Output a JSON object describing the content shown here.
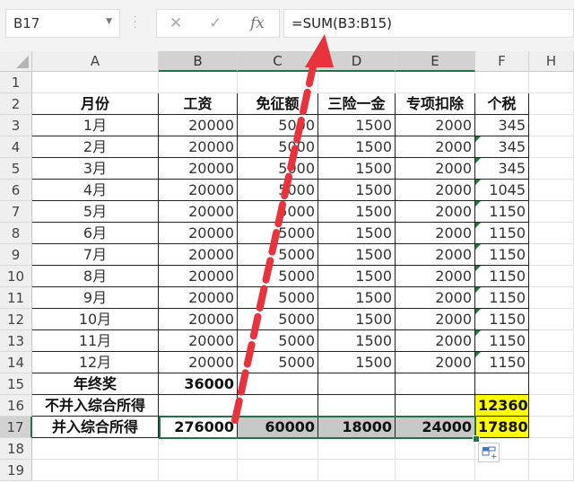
{
  "namebox": {
    "value": "B17"
  },
  "formula_bar": {
    "cancel_icon": "✕",
    "enter_icon": "✓",
    "fx_label": "fx",
    "formula": "=SUM(B3:B15)"
  },
  "columns": [
    "A",
    "B",
    "C",
    "D",
    "E",
    "F",
    "H"
  ],
  "rows": [
    "1",
    "2",
    "3",
    "4",
    "5",
    "6",
    "7",
    "8",
    "9",
    "10",
    "11",
    "12",
    "13",
    "14",
    "15",
    "16",
    "17",
    "18",
    "19"
  ],
  "headers": {
    "month": "月份",
    "salary": "工资",
    "exemption": "免征额",
    "insurance": "三险一金",
    "special_deduction": "专项扣除",
    "tax": "个税"
  },
  "monthly": [
    {
      "month": "1月",
      "salary": "20000",
      "exemption": "5000",
      "insurance": "1500",
      "deduction": "2000",
      "tax": "345"
    },
    {
      "month": "2月",
      "salary": "20000",
      "exemption": "5000",
      "insurance": "1500",
      "deduction": "2000",
      "tax": "345"
    },
    {
      "month": "3月",
      "salary": "20000",
      "exemption": "5000",
      "insurance": "1500",
      "deduction": "2000",
      "tax": "345"
    },
    {
      "month": "4月",
      "salary": "20000",
      "exemption": "5000",
      "insurance": "1500",
      "deduction": "2000",
      "tax": "1045"
    },
    {
      "month": "5月",
      "salary": "20000",
      "exemption": "5000",
      "insurance": "1500",
      "deduction": "2000",
      "tax": "1150"
    },
    {
      "month": "6月",
      "salary": "20000",
      "exemption": "5000",
      "insurance": "1500",
      "deduction": "2000",
      "tax": "1150"
    },
    {
      "month": "7月",
      "salary": "20000",
      "exemption": "5000",
      "insurance": "1500",
      "deduction": "2000",
      "tax": "1150"
    },
    {
      "month": "8月",
      "salary": "20000",
      "exemption": "5000",
      "insurance": "1500",
      "deduction": "2000",
      "tax": "1150"
    },
    {
      "month": "9月",
      "salary": "20000",
      "exemption": "5000",
      "insurance": "1500",
      "deduction": "2000",
      "tax": "1150"
    },
    {
      "month": "10月",
      "salary": "20000",
      "exemption": "5000",
      "insurance": "1500",
      "deduction": "2000",
      "tax": "1150"
    },
    {
      "month": "11月",
      "salary": "20000",
      "exemption": "5000",
      "insurance": "1500",
      "deduction": "2000",
      "tax": "1150"
    },
    {
      "month": "12月",
      "salary": "20000",
      "exemption": "5000",
      "insurance": "1500",
      "deduction": "2000",
      "tax": "1150"
    }
  ],
  "bonus": {
    "label": "年终奖",
    "value": "36000"
  },
  "separate": {
    "label": "不并入综合所得",
    "tax": "12360"
  },
  "combined": {
    "label": "并入综合所得",
    "salary": "276000",
    "exemption": "60000",
    "insurance": "18000",
    "deduction": "24000",
    "tax": "17880"
  },
  "colors": {
    "highlight_yellow": "#ffff00",
    "selection_green": "#217346",
    "annotation_red": "#e8323c"
  }
}
